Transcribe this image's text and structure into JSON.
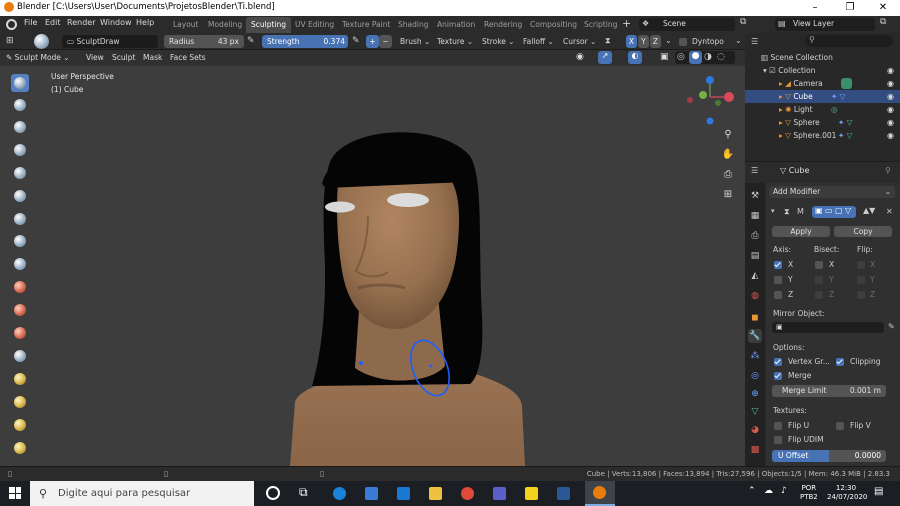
{
  "window": {
    "title": "Blender [C:\\Users\\User\\Documents\\ProjetosBlender\\Ti.blend]",
    "minimize": "–",
    "maximize": "❐",
    "close": "✕"
  },
  "menu": [
    "File",
    "Edit",
    "Render",
    "Window",
    "Help"
  ],
  "workspaces": [
    "Layout",
    "Modeling",
    "Sculpting",
    "UV Editing",
    "Texture Paint",
    "Shading",
    "Animation",
    "Rendering",
    "Compositing",
    "Scripting"
  ],
  "active_workspace": "Sculpting",
  "scene": "Scene",
  "view_layer": "View Layer",
  "tool_header": {
    "brush_name": "SculptDraw",
    "radius_label": "Radius",
    "radius_value": "43 px",
    "strength_label": "Strength",
    "strength_value": "0.374",
    "plus": "+",
    "minus": "−",
    "brush": "Brush",
    "texture": "Texture",
    "stroke": "Stroke",
    "falloff": "Falloff",
    "cursor": "Cursor",
    "axis_x": "X",
    "axis_y": "Y",
    "axis_z": "Z",
    "dyntopo": "Dyntopo"
  },
  "mode_header": {
    "mode": "Sculpt Mode",
    "menus": [
      "View",
      "Sculpt",
      "Mask",
      "Face Sets"
    ]
  },
  "viewport": {
    "perspective": "User Perspective",
    "object": "(1) Cube"
  },
  "outliner": {
    "scene_collection": "Scene Collection",
    "collection": "Collection",
    "items": [
      "Camera",
      "Cube",
      "Light",
      "Sphere",
      "Sphere.001"
    ],
    "selected": "Cube"
  },
  "properties": {
    "object": "Cube",
    "add_modifier": "Add Modifier",
    "modifier_m": "M",
    "apply": "Apply",
    "copy": "Copy",
    "axis": "Axis:",
    "bisect": "Bisect:",
    "flip": "Flip:",
    "x": "X",
    "y": "Y",
    "z": "Z",
    "mirror_object": "Mirror Object:",
    "options": "Options:",
    "vertex_groups": "Vertex Gr...",
    "clipping": "Clipping",
    "merge": "Merge",
    "merge_limit_label": "Merge Limit",
    "merge_limit_value": "0.001 m",
    "textures": "Textures:",
    "flip_u": "Flip U",
    "flip_v": "Flip V",
    "flip_udim": "Flip UDIM",
    "u_offset_label": "U Offset",
    "u_offset_value": "0.0000"
  },
  "status": {
    "text": "Cube | Verts:13,806 | Faces:13,894 | Tris:27,596 | Objects:1/5 | Mem: 46.3 MiB | 2.83.3"
  },
  "taskbar": {
    "search_placeholder": "Digite aqui para pesquisar",
    "lang": "POR",
    "layout": "PTB2",
    "time": "12:30",
    "date": "24/07/2020"
  },
  "colors": {
    "accent": "#4772b3",
    "selection": "#334d80",
    "viewport_bg": "#3d3d3d",
    "skin": "#9d7456",
    "hair": "#050505"
  }
}
